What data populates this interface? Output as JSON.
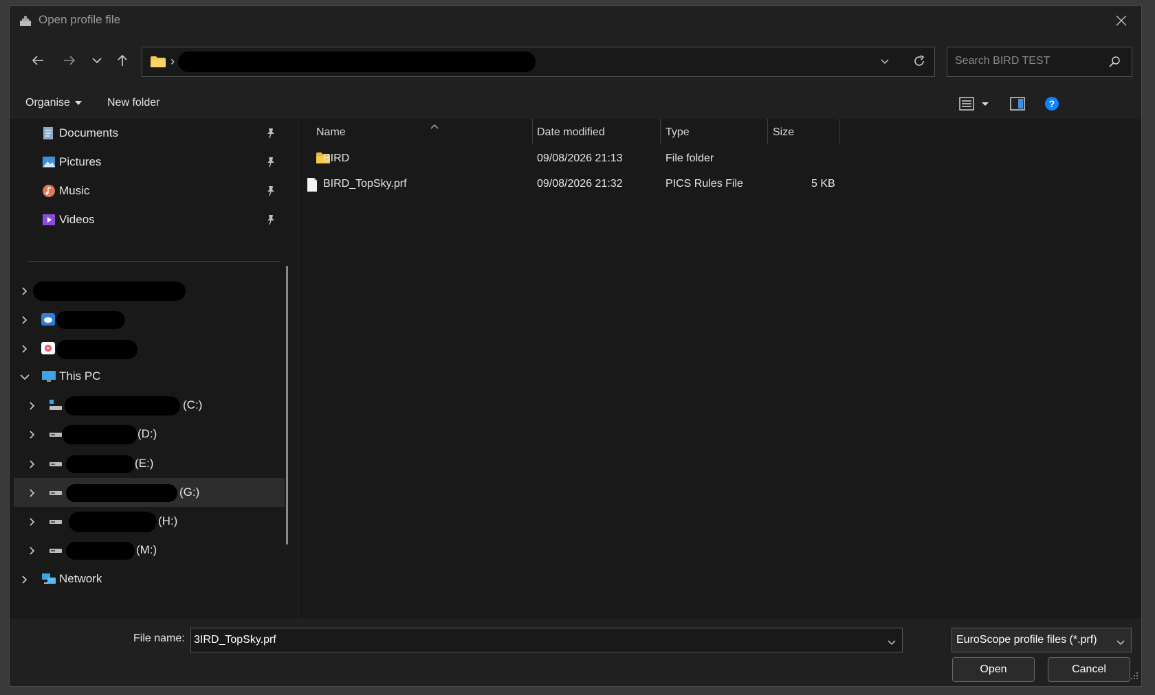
{
  "window": {
    "title": "Open profile file"
  },
  "navigation": {
    "search_placeholder": "Search BIRD TEST",
    "address_separator": "›"
  },
  "commandbar": {
    "organise_label": "Organise",
    "new_folder_label": "New folder"
  },
  "sidebar": {
    "quick_access": [
      {
        "label": "Documents",
        "icon": "documents-icon"
      },
      {
        "label": "Pictures",
        "icon": "pictures-icon"
      },
      {
        "label": "Music",
        "icon": "music-icon"
      },
      {
        "label": "Videos",
        "icon": "videos-icon"
      }
    ],
    "this_pc_label": "This PC",
    "drives": [
      {
        "letter": "(C:)"
      },
      {
        "letter": "(D:)"
      },
      {
        "letter": "(E:)"
      },
      {
        "letter": "(G:)"
      },
      {
        "letter": "(H:)"
      },
      {
        "letter": "(M:)"
      }
    ],
    "network_label": "Network"
  },
  "columns": {
    "name": "Name",
    "date": "Date modified",
    "type": "Type",
    "size": "Size"
  },
  "files": [
    {
      "name": "BIRD",
      "date": "09/08/2026 21:13",
      "type": "File folder",
      "size": "",
      "icon": "folder-icon"
    },
    {
      "name": "BIRD_TopSky.prf",
      "date": "09/08/2026 21:32",
      "type": "PICS Rules File",
      "size": "5 KB",
      "icon": "file-icon"
    }
  ],
  "footer": {
    "file_name_label": "File name:",
    "file_name_value": "3IRD_TopSky.prf",
    "file_type_value": "EuroScope profile files (*.prf)",
    "open_label": "Open",
    "cancel_label": "Cancel"
  },
  "colors": {
    "accent": "#0a84ff",
    "folder": "#f7c948",
    "background": "#191919",
    "chrome": "#202020"
  }
}
